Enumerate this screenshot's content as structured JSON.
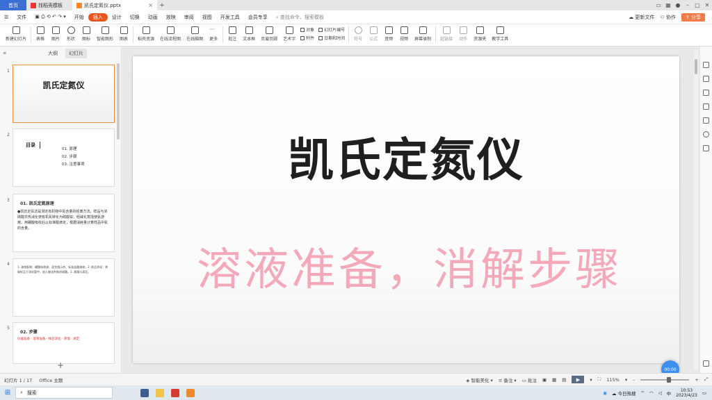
{
  "tabs": {
    "home": "首页",
    "tab1": "找稻壳模板",
    "active_doc": "凯氏定氮仪.pptx"
  },
  "menu": {
    "file": "文件",
    "items": [
      "开始",
      "插入",
      "设计",
      "切换",
      "动画",
      "放映",
      "审阅",
      "视图",
      "开发工具",
      "会员专享"
    ],
    "active_index": 1,
    "search_placeholder": "查找命令、搜索模板",
    "unsync": "更新文件",
    "collab": "协作",
    "share": "分享"
  },
  "ribbon": {
    "buttons": [
      "新建幻灯片",
      "表格",
      "图片",
      "形状",
      "图标",
      "智能图形",
      "图表",
      "稻壳资源",
      "在线流程图",
      "在线脑图",
      "更多",
      "批注",
      "文本框",
      "页眉页脚",
      "艺术字"
    ],
    "stack1": [
      "对象",
      "附件"
    ],
    "stack2": [
      "幻灯片编号",
      "日期和时间"
    ],
    "buttons2": [
      "符号",
      "公式",
      "音频",
      "视频",
      "屏幕录制",
      "超链接",
      "动作",
      "资源夹",
      "教学工具"
    ]
  },
  "left_panel": {
    "tab_outline": "大纲",
    "tab_slides": "幻灯片",
    "thumbs": [
      {
        "num": "1",
        "title": "凯氏定氮仪"
      },
      {
        "num": "2",
        "heading": "目录",
        "items": [
          "01. 原理",
          "02. 步骤",
          "03. 注意事项"
        ]
      },
      {
        "num": "3",
        "heading": "01. 凯氏定氮原理",
        "body": "●凯氏定氮法是测定有机物中氮含量的经典方法。样品与浓硫酸共热消化使有机氮转化为硫酸铵，经碱化蒸馏使氨游离，用硼酸吸收后以标准酸滴定，根据消耗量计算样品中氮的含量。"
      },
      {
        "num": "4",
        "body": "1. 溶液配制：硼酸吸收液、混合指示剂、标准盐酸溶液。2. 样品消化：称取样品于消化管中，加入催化剂和浓硫酸。3. 蒸馏与滴定。"
      },
      {
        "num": "5",
        "heading": "02. 步骤",
        "body": "仪器准备 · 溶液准备 · 样品消化 · 蒸馏 · 滴定"
      }
    ]
  },
  "slide": {
    "title": "凯氏定氮仪",
    "overlay": "溶液准备，消解步骤",
    "timer": "00:00"
  },
  "status": {
    "slide_info": "幻灯片 1 / 17",
    "theme": "Office 主题",
    "smart_beautify": "智能美化",
    "notes": "备注",
    "annot": "批注",
    "zoom": "115%"
  },
  "taskbar": {
    "search": "搜索",
    "weather": "今日热搜",
    "time": "10:53",
    "date": "2023/4/23"
  },
  "colors": {
    "accent_orange": "#e8561f",
    "home_tab": "#3b6fd6",
    "overlay_pink": "#f4a9bb"
  }
}
